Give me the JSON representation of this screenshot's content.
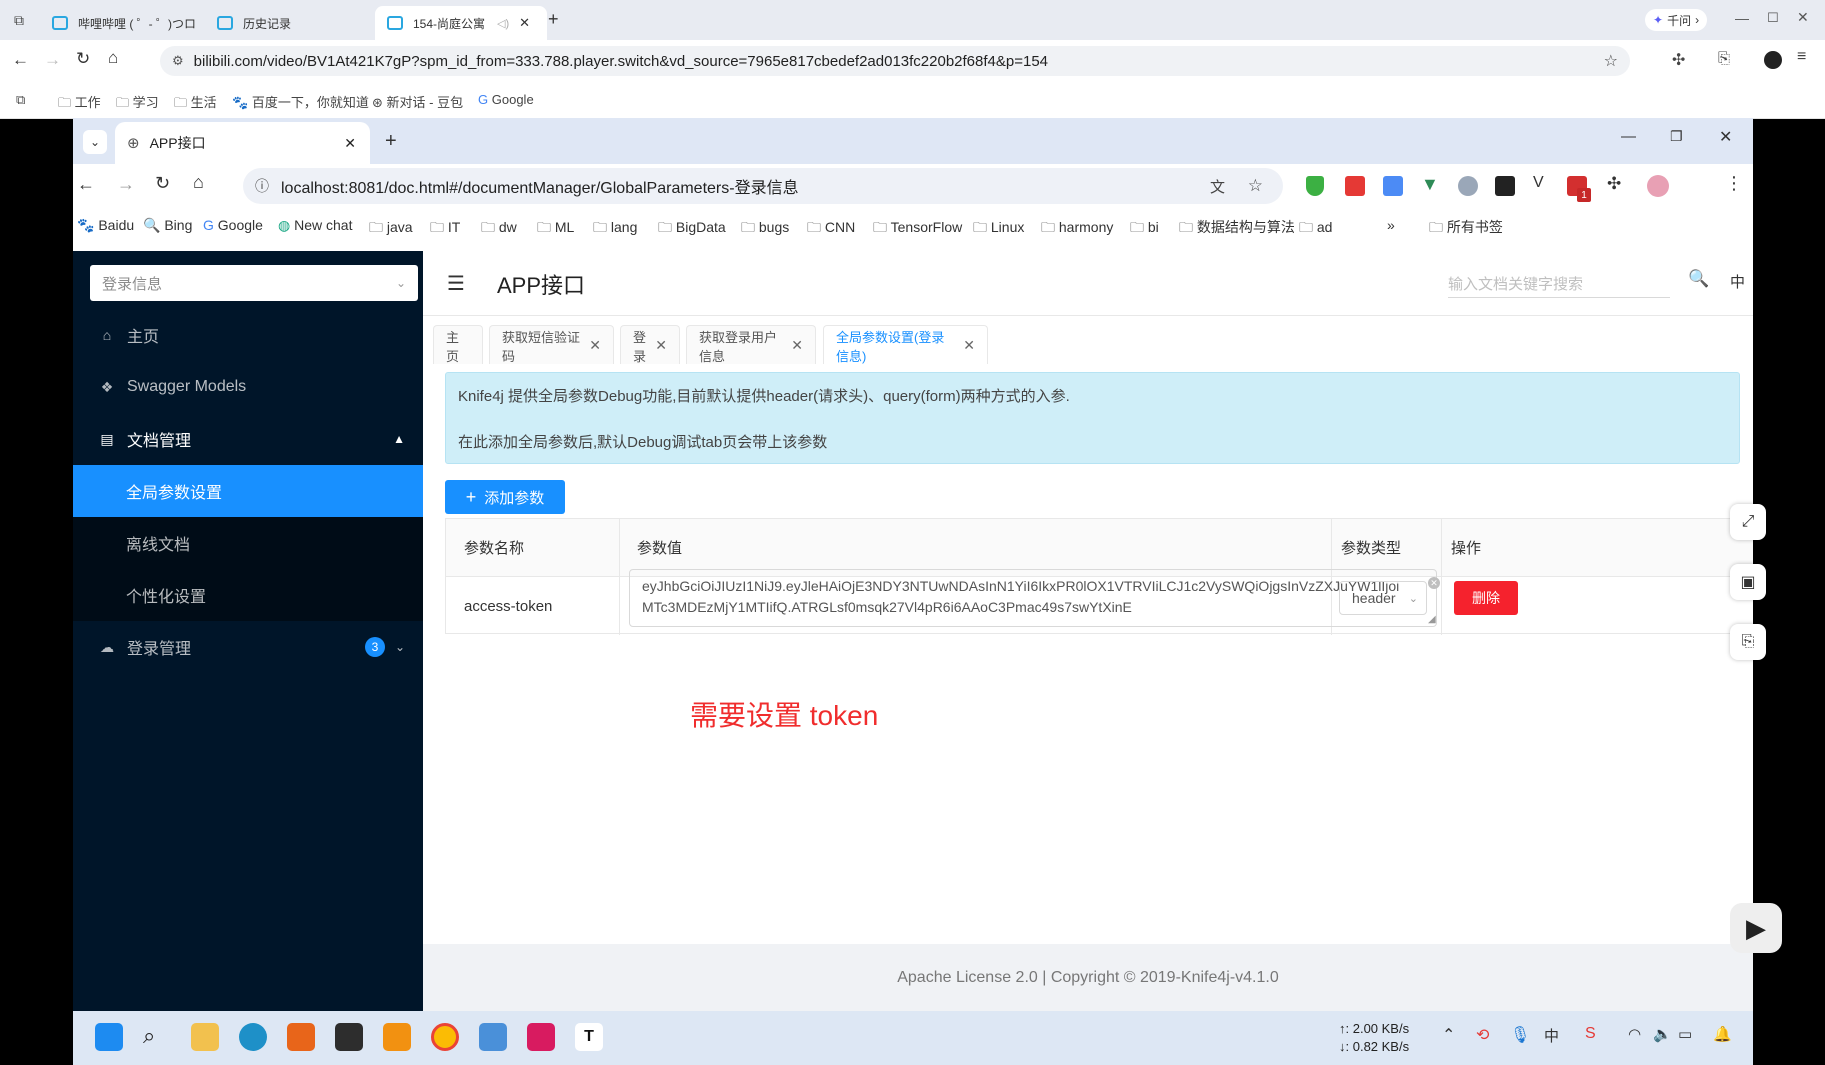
{
  "outer": {
    "tabs": [
      {
        "label": "哔哩哔哩 ( ゜- ゜)つロ"
      },
      {
        "label": "历史记录"
      },
      {
        "label": "154-尚庭公寓"
      }
    ],
    "url": "bilibili.com/video/BV1At421K7gP?spm_id_from=333.788.player.switch&vd_source=7965e817cbedef2ad013fc220b2f68f4&p=154",
    "qianwen": "千问",
    "bookmarks": [
      "工作",
      "学习",
      "生活",
      "百度一下，你就知道",
      "新对话 - 豆包",
      "Google"
    ]
  },
  "inner": {
    "tab": "APP接口",
    "url": "localhost:8081/doc.html#/documentManager/GlobalParameters-登录信息",
    "bookmarks": [
      "Baidu",
      "Bing",
      "Google",
      "New chat",
      "java",
      "IT",
      "dw",
      "ML",
      "lang",
      "BigData",
      "bugs",
      "CNN",
      "TensorFlow",
      "Linux",
      "harmony",
      "bi",
      "数据结构与算法",
      "ad",
      "所有书签"
    ],
    "ext_badge": "1"
  },
  "sidebar": {
    "search_value": "登录信息",
    "items": [
      {
        "label": "主页"
      },
      {
        "label": "Swagger Models"
      },
      {
        "label": "文档管理"
      },
      {
        "label": "全局参数设置"
      },
      {
        "label": "离线文档"
      },
      {
        "label": "个性化设置"
      },
      {
        "label": "登录管理",
        "badge": "3"
      }
    ]
  },
  "header": {
    "title": "APP接口",
    "search_placeholder": "输入文档关键字搜索",
    "lang": "中"
  },
  "tabs": [
    {
      "label": "主页"
    },
    {
      "label": "获取短信验证码"
    },
    {
      "label": "登录"
    },
    {
      "label": "获取登录用户信息"
    },
    {
      "label": "全局参数设置(登录信息)"
    }
  ],
  "alert": {
    "line1": "Knife4j 提供全局参数Debug功能,目前默认提供header(请求头)、query(form)两种方式的入参.",
    "line2": "在此添加全局参数后,默认Debug调试tab页会带上该参数"
  },
  "add_button": "添加参数",
  "table": {
    "headers": [
      "参数名称",
      "参数值",
      "参数类型",
      "操作"
    ],
    "rows": [
      {
        "name": "access-token",
        "value": "eyJhbGciOiJIUzI1NiJ9.eyJleHAiOjE3NDY3NTUwNDAsInN1YiI6IkxPR0lOX1VTRVIiLCJ1c2VySWQiOjgsInVzZXJuYW1lIjoiMTc3MDEzMjY1MTIifQ.ATRGLsf0msqk27Vl4pR6i6AAoC3Pmac49s7swYtXinE",
        "type": "header",
        "action": "删除"
      }
    ]
  },
  "annotation": "需要设置 token",
  "footer": "Apache License 2.0 | Copyright © 2019-Knife4j-v4.1.0",
  "taskbar": {
    "net_up": "↑: 2.00 KB/s",
    "net_down": "↓: 0.82 KB/s",
    "t_app": "T"
  }
}
